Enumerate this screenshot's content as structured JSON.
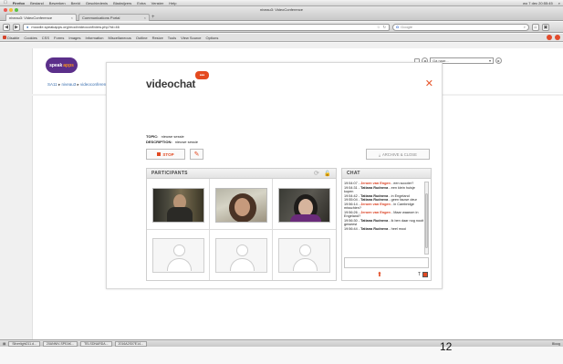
{
  "menubar": {
    "apple": "",
    "app": "Firefox",
    "items": [
      "Bestand",
      "Bewerken",
      "Beeld",
      "Geschiedenis",
      "Bladwijzers",
      "Extra",
      "Venster",
      "Help"
    ],
    "clock": "wo 7 dec 20:55:45"
  },
  "browser": {
    "window_title": "niveau3: VideoConference",
    "tabs": [
      {
        "label": "niveau3: VideoConference",
        "active": true
      },
      {
        "label": "Communications Portal",
        "active": false
      }
    ],
    "url": "moodle.speakapps.org/mod/videoconf/view.php?id=46",
    "search_placeholder": "Google",
    "bookmarks": [
      "Disable",
      "Cookies",
      "CSS",
      "Forms",
      "Images",
      "Information",
      "Miscellaneous",
      "Outline",
      "Resize",
      "Tools",
      "View Source",
      "Options"
    ]
  },
  "site": {
    "logo_text": "speak",
    "logo_accent": "apps",
    "breadcrumb": [
      "SA11",
      "niveau3",
      "videoconferences",
      "VideoConference"
    ],
    "search_value": "Ga naar...",
    "search_caret": "▾",
    "go_label": "▸"
  },
  "videochat": {
    "title": "videochat",
    "badge": "•••",
    "close": "✕",
    "topic_label": "TOPIC:",
    "topic_value": "nieuwe sessie",
    "description_label": "DESCRIPTION:",
    "description_value": "nieuwe sessie",
    "stop_label": "STOP",
    "archive_label": "ARCHIVE & CLOSE",
    "participants_label": "PARTICIPANTS",
    "chat_label": "CHAT",
    "messages": [
      {
        "time": "19:54:07",
        "name": "Jeroen van Engen",
        "color": "red",
        "text": "een scooter?"
      },
      {
        "time": "19:54:31",
        "name": "Tatiana Rudneva",
        "color": "dark",
        "text": "een klein huisje kopen"
      },
      {
        "time": "19:54:42",
        "name": "Tatiana Rudneva",
        "color": "dark",
        "text": "in Engeland"
      },
      {
        "time": "19:55:04",
        "name": "Tatiana Rudneva",
        "color": "dark",
        "text": "geen fauwe deur"
      },
      {
        "time": "19:56:14",
        "name": "Jeroen van Engen",
        "color": "red",
        "text": "in Cambridge misschien?"
      },
      {
        "time": "19:56:26",
        "name": "Jeroen van Engen",
        "color": "red",
        "text": "Maar waarom in Engeland?"
      },
      {
        "time": "19:56:30",
        "name": "Tatiana Rudneva",
        "color": "dark",
        "text": "ik ben daar nog nooit geweest"
      },
      {
        "time": "19:56:44",
        "name": "Tatiana Rudneva",
        "color": "dark",
        "text": "heel mooi"
      }
    ],
    "text_tool": "T"
  },
  "downloads": {
    "items": [
      "Silverlight211.d...",
      "20ANNIV-SPEAK...",
      "TELSDNARDA...",
      "2016A2S07E14..."
    ],
    "right": "Bloog"
  },
  "slide_number": "12",
  "colors": {
    "accent": "#e24a22",
    "brand_purple": "#5b2f8a",
    "name_red": "#d93b1c"
  }
}
